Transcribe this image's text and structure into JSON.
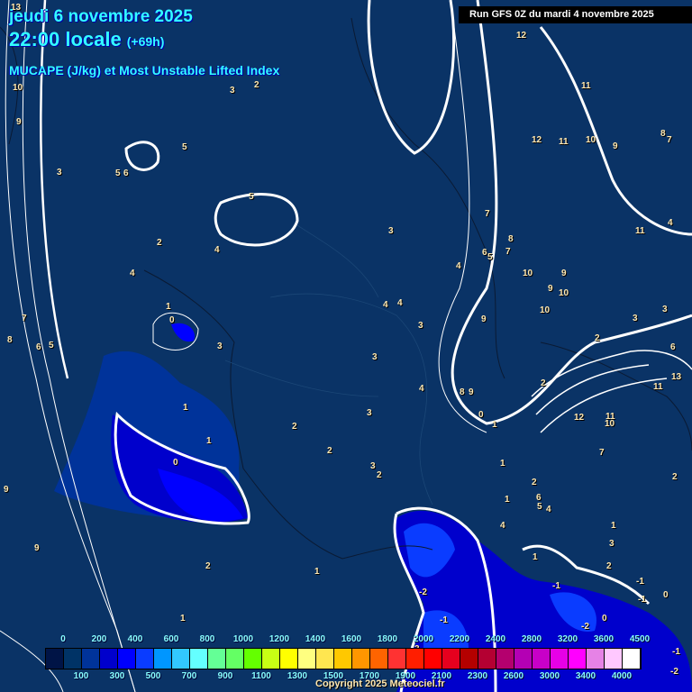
{
  "header": {
    "date": "jeudi 6 novembre 2025",
    "time": "22:00 locale",
    "lead": "(+69h)",
    "parameter": "MUCAPE (J/kg) et Most Unstable Lifted Index",
    "run": "Run GFS 0Z du mardi 4 novembre 2025"
  },
  "map_labels": [
    "13",
    "10",
    "9",
    "3",
    "3",
    "2",
    "5",
    "5",
    "6",
    "5",
    "2",
    "4",
    "4",
    "1",
    "0",
    "3",
    "7",
    "6",
    "5",
    "8",
    "1",
    "1",
    "0",
    "9",
    "9",
    "2",
    "1",
    "1",
    "3",
    "3",
    "4",
    "4",
    "3",
    "3",
    "3",
    "4",
    "2",
    "2",
    "3",
    "2",
    "1",
    "0",
    "1",
    "8",
    "9",
    "4",
    "7",
    "6",
    "5",
    "9",
    "10",
    "9",
    "10",
    "10",
    "9",
    "8",
    "7",
    "12",
    "11",
    "12",
    "11",
    "10",
    "9",
    "8",
    "7",
    "11",
    "11",
    "4",
    "3",
    "3",
    "6",
    "2",
    "12",
    "13",
    "11",
    "10",
    "2",
    "7",
    "2",
    "2",
    "1",
    "6",
    "5",
    "4",
    "4",
    "1",
    "3",
    "2",
    "1",
    "-1",
    "-2",
    "0",
    "-1",
    "-1",
    "-2",
    "-1",
    "0",
    "-1",
    "-2",
    "3"
  ],
  "colorbar": {
    "labels": [
      "0",
      "100",
      "200",
      "300",
      "400",
      "500",
      "600",
      "700",
      "800",
      "900",
      "1000",
      "1100",
      "1200",
      "1300",
      "1400",
      "1500",
      "1600",
      "1700",
      "1800",
      "1900",
      "2000",
      "2100",
      "2200",
      "2300",
      "2400",
      "2600",
      "2800",
      "3000",
      "3200",
      "3400",
      "3600",
      "4000",
      "4500"
    ],
    "colors": [
      "#001446",
      "#003366",
      "#00339a",
      "#0000cc",
      "#0000ff",
      "#0a3cff",
      "#0096ff",
      "#32c8ff",
      "#64ffff",
      "#64ff96",
      "#64ff64",
      "#64ff00",
      "#c8ff14",
      "#ffff00",
      "#ffff80",
      "#ffe650",
      "#ffc800",
      "#ff9600",
      "#ff6400",
      "#ff3232",
      "#ff1e00",
      "#ff0000",
      "#e6001e",
      "#b40000",
      "#b40032",
      "#b4006e",
      "#b400b4",
      "#c800c8",
      "#e600e6",
      "#ff00ff",
      "#e682e6",
      "#ffc8ff",
      "#ffffff"
    ]
  },
  "copyright": "Copyright 2025 Meteociel.fr"
}
